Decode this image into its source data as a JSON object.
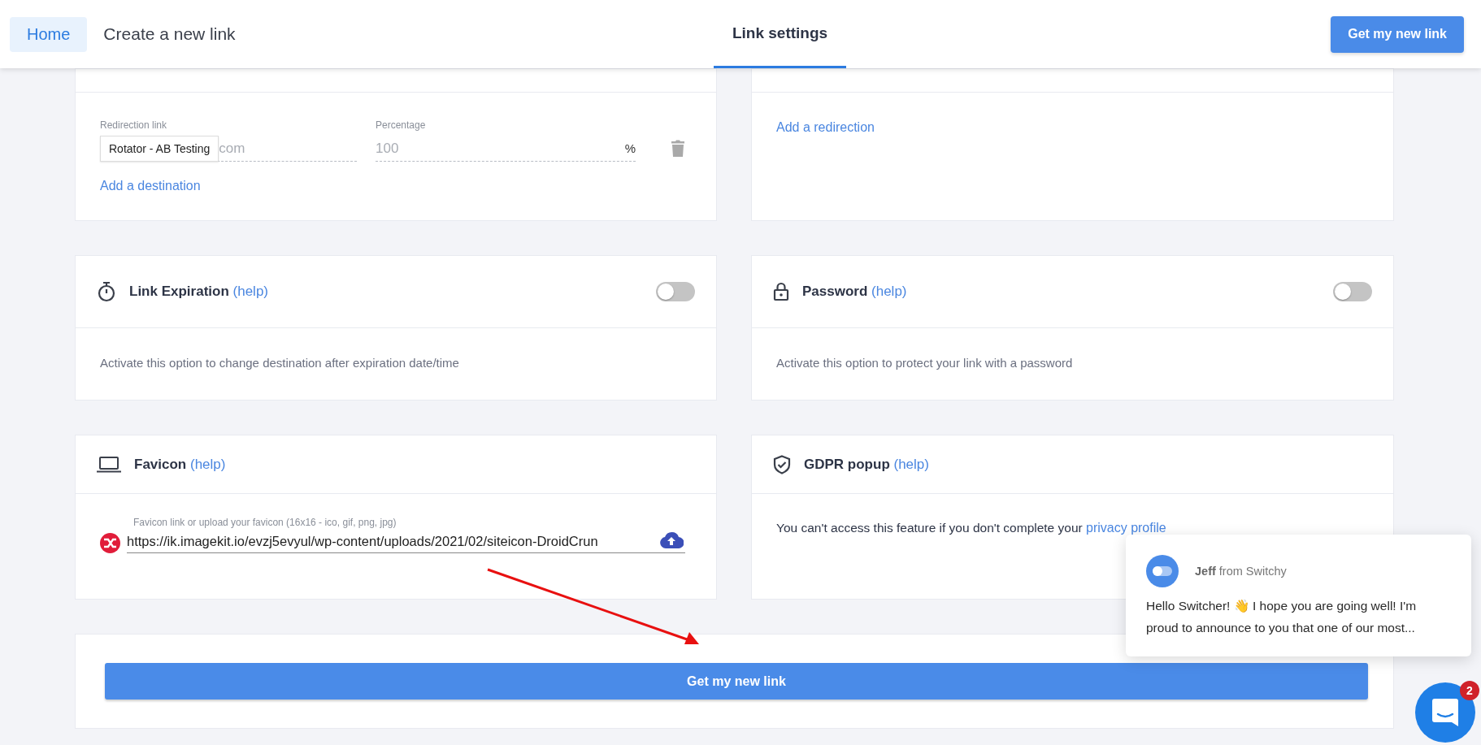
{
  "header": {
    "home": "Home",
    "title": "Create a new link",
    "tabs": [
      {
        "label": "Link settings",
        "selected": true
      }
    ],
    "cta": "Get my new link"
  },
  "rotator_card": {
    "fields": [
      {
        "label": "Redirection link",
        "placeholder": "com",
        "tooltip": "Rotator - AB Testing"
      },
      {
        "label": "Percentage",
        "placeholder": "100",
        "suffix": "%"
      }
    ],
    "add_link": "Add a destination"
  },
  "redirect_card": {
    "add_link": "Add a redirection"
  },
  "options": [
    {
      "kind": "toggle",
      "title": "Link Expiration",
      "help": "(help)",
      "on": false,
      "description": "Activate this option to change destination after expiration date/time"
    },
    {
      "kind": "toggle",
      "title": "Password",
      "help": "(help)",
      "on": false,
      "description": "Activate this option to protect your link with a password"
    },
    {
      "kind": "favicon",
      "title": "Favicon",
      "help": "(help)",
      "label": "Favicon link or upload your favicon (16x16 - ico, gif, png, jpg)",
      "value": "https://ik.imagekit.io/evzj5evyul/wp-content/uploads/2021/02/siteicon-DroidCrun"
    },
    {
      "kind": "notice",
      "title": "GDPR popup",
      "help": "(help)",
      "description": "You can't access this feature if you don't complete your ",
      "link": "privacy profile"
    }
  ],
  "submit": "Get my new link",
  "chat": {
    "sender": "**Jeff** from Switchy",
    "message": "Hello Switcher! 👋 I hope you are going well! I'm proud to announce to you that one of our most...",
    "unread": "2"
  }
}
